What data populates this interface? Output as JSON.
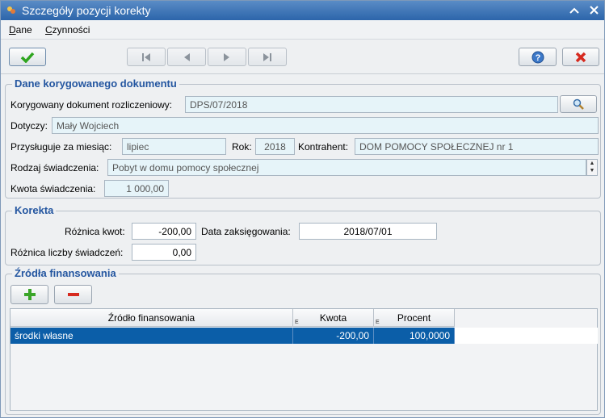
{
  "window": {
    "title": "Szczegóły pozycji korekty"
  },
  "menu": {
    "items": [
      {
        "label_accel": "D",
        "label_rest": "ane"
      },
      {
        "label_accel": "C",
        "label_rest": "zynności"
      }
    ]
  },
  "icons": {
    "confirm": "checkmark-icon",
    "first": "first-record-icon",
    "prev": "previous-record-icon",
    "next": "next-record-icon",
    "last": "last-record-icon",
    "help": "help-icon",
    "cancel": "cancel-icon",
    "search": "search-icon",
    "add": "plus-icon",
    "remove": "minus-icon"
  },
  "colors": {
    "title_accent": "#2456a0",
    "selected_row": "#0b5ea8",
    "readonly_field": "#e6f4f9"
  },
  "dokument": {
    "section_title": "Dane korygowanego dokumentu",
    "dokument_label": "Korygowany dokument rozliczeniowy:",
    "dokument_value": "DPS/07/2018",
    "dotyczy_label": "Dotyczy:",
    "dotyczy_value": "Mały Wojciech",
    "miesiac_label": "Przysługuje za miesiąc:",
    "miesiac_value": "lipiec",
    "rok_label": "Rok:",
    "rok_value": "2018",
    "kontrahent_label": "Kontrahent:",
    "kontrahent_value": "DOM POMOCY SPOŁECZNEJ nr 1",
    "rodzaj_label": "Rodzaj świadczenia:",
    "rodzaj_value": "Pobyt w domu pomocy społecznej",
    "kwota_label": "Kwota świadczenia:",
    "kwota_value": "1 000,00"
  },
  "korekta": {
    "section_title": "Korekta",
    "roznica_kwot_label": "Różnica kwot:",
    "roznica_kwot_value": "-200,00",
    "data_label": "Data zaksięgowania:",
    "data_value": "2018/07/01",
    "roznica_liczby_label": "Różnica liczby świadczeń:",
    "roznica_liczby_value": "0,00"
  },
  "zrodla": {
    "section_title": "Źródła finansowania",
    "columns": [
      {
        "label": "Źródło finansowania",
        "marker": ""
      },
      {
        "label": "Kwota",
        "marker": "E"
      },
      {
        "label": "Procent",
        "marker": "E"
      }
    ],
    "rows": [
      {
        "zrodlo": "środki własne",
        "kwota": "-200,00",
        "procent": "100,0000"
      }
    ]
  }
}
